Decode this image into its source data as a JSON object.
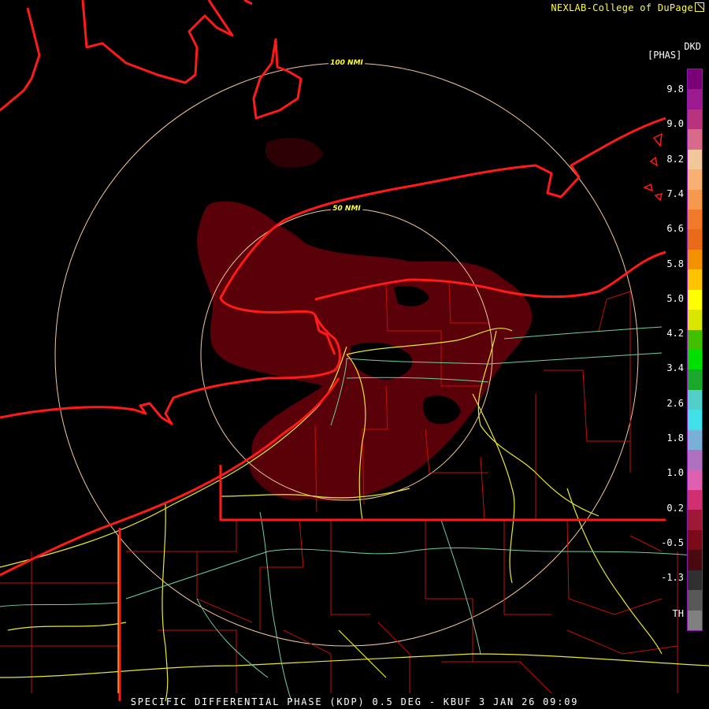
{
  "credit": "NEXLAB-College of DuPage",
  "units": {
    "product": "DKD",
    "unit": "[PHAS]"
  },
  "range_rings": [
    {
      "label": "100 NMI"
    },
    {
      "label": "50 NMI"
    }
  ],
  "colorbar": {
    "ticks": [
      "9.8",
      "9.0",
      "8.2",
      "7.4",
      "6.6",
      "5.8",
      "5.0",
      "4.2",
      "3.4",
      "2.6",
      "1.8",
      "1.0",
      "0.2",
      "-0.5",
      "-1.3",
      "TH"
    ],
    "colors": [
      "#7a0077",
      "#9c1a8e",
      "#b8337c",
      "#d86a8a",
      "#f2c89a",
      "#f8b073",
      "#f59a4d",
      "#f07a2a",
      "#e96a17",
      "#f39200",
      "#ffc400",
      "#ffff00",
      "#d9e600",
      "#40c000",
      "#00e000",
      "#1aa82a",
      "#50d0c8",
      "#40e0e8",
      "#7ab0d8",
      "#b070c0",
      "#e060b0",
      "#d03070",
      "#a01838",
      "#7a0a18",
      "#4a0810",
      "#303030",
      "#585858",
      "#808080"
    ]
  },
  "caption": "SPECIFIC DIFFERENTIAL PHASE (KDP) 0.5 DEG - KBUF 3 JAN 26 09:09"
}
